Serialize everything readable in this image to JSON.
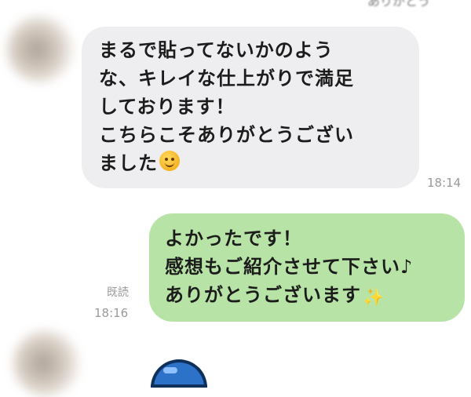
{
  "chat": {
    "header_partial": "ありがとう",
    "messages": [
      {
        "direction": "incoming",
        "lines": [
          "まるで貼ってないかのよう",
          "な、キレイな仕上がりで満足",
          "しております！",
          "こちらこそありがとうござい",
          "ました"
        ],
        "emoji": "smiling-face",
        "time": "18:14"
      },
      {
        "direction": "outgoing",
        "lines": [
          "よかったです！",
          "感想もご紹介させて下さい♪",
          "ありがとうございます"
        ],
        "emoji": "sparkles",
        "read_label": "既読",
        "time": "18:16"
      }
    ]
  },
  "colors": {
    "incoming_bubble": "#eeeef0",
    "outgoing_bubble": "#b7e4a6",
    "meta_text": "#9a9a9a"
  }
}
